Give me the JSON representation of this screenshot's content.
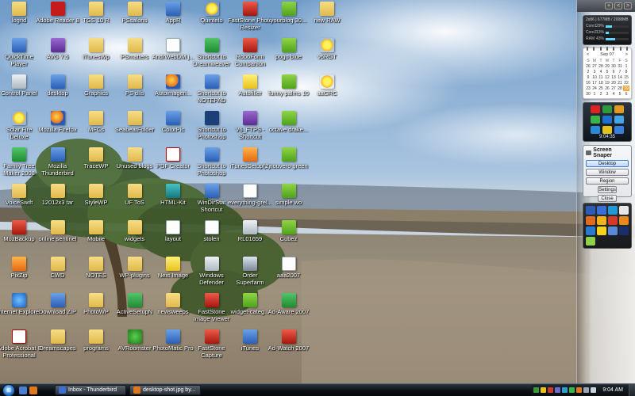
{
  "desktop": {
    "icons": [
      {
        "label": "logrid",
        "glyph": "folder",
        "col": 0,
        "row": 0
      },
      {
        "label": "Adobe Reader 8",
        "glyph": "pdf-red",
        "col": 1,
        "row": 0
      },
      {
        "label": "TGS 10 R",
        "glyph": "folder",
        "col": 2,
        "row": 0
      },
      {
        "label": "PSsalons",
        "glyph": "folder",
        "col": 3,
        "row": 0
      },
      {
        "label": "AppR",
        "glyph": "blue",
        "col": 4,
        "row": 0
      },
      {
        "label": "Quinteto",
        "glyph": "sun",
        "col": 5,
        "row": 0
      },
      {
        "label": "FastStone Photo Resizer",
        "glyph": "red",
        "col": 6,
        "row": 0
      },
      {
        "label": "yourblog 30...",
        "glyph": "pea",
        "col": 7,
        "row": 0
      },
      {
        "label": "new RAW",
        "glyph": "folder",
        "col": 8,
        "row": 0
      },
      {
        "label": "QuickTime Player",
        "glyph": "blue",
        "col": 0,
        "row": 1
      },
      {
        "label": "AVG 7.5",
        "glyph": "purple",
        "col": 1,
        "row": 1
      },
      {
        "label": "iTunesWp",
        "glyph": "folder",
        "col": 2,
        "row": 1
      },
      {
        "label": "PSmatters",
        "glyph": "folder",
        "col": 3,
        "row": 1
      },
      {
        "label": "AndrWebDM j...",
        "glyph": "doc",
        "col": 4,
        "row": 1
      },
      {
        "label": "Shortcut to Dreamweaver",
        "glyph": "green",
        "col": 5,
        "row": 1
      },
      {
        "label": "RoboForm Companion",
        "glyph": "red",
        "col": 6,
        "row": 1
      },
      {
        "label": "pogo blue",
        "glyph": "pea",
        "col": 7,
        "row": 1
      },
      {
        "label": "v6RGT",
        "glyph": "sun",
        "col": 8,
        "row": 1
      },
      {
        "label": "Control Panel",
        "glyph": "gray",
        "col": 0,
        "row": 2
      },
      {
        "label": "desktop",
        "glyph": "blue",
        "col": 1,
        "row": 2
      },
      {
        "label": "Graphics",
        "glyph": "folder",
        "col": 2,
        "row": 2
      },
      {
        "label": "PS dlls",
        "glyph": "folder",
        "col": 3,
        "row": 2
      },
      {
        "label": "Autoimageri...",
        "glyph": "fire",
        "col": 4,
        "row": 2
      },
      {
        "label": "Shortcut to NOTEPAD",
        "glyph": "blue",
        "col": 5,
        "row": 2
      },
      {
        "label": "Autofiller",
        "glyph": "yellow",
        "col": 6,
        "row": 2
      },
      {
        "label": "funny palms 10",
        "glyph": "pea",
        "col": 7,
        "row": 2
      },
      {
        "label": "aaGRC",
        "glyph": "sun",
        "col": 8,
        "row": 2
      },
      {
        "label": "Solar Fire Deluxe",
        "glyph": "sun",
        "col": 0,
        "row": 3
      },
      {
        "label": "Mozilla Firefox",
        "glyph": "fire",
        "col": 1,
        "row": 3
      },
      {
        "label": "MFCs",
        "glyph": "folder",
        "col": 2,
        "row": 3
      },
      {
        "label": "SeabeatFolder",
        "glyph": "folder",
        "col": 3,
        "row": 3
      },
      {
        "label": "ColorPic",
        "glyph": "blue",
        "col": 4,
        "row": 3
      },
      {
        "label": "Shortcut to Photoshop",
        "glyph": "ps",
        "col": 5,
        "row": 3
      },
      {
        "label": "V6_FTPS - Shortcut",
        "glyph": "purple",
        "col": 6,
        "row": 3
      },
      {
        "label": "octave drake...",
        "glyph": "pea",
        "col": 7,
        "row": 3
      },
      {
        "label": "Family Tree Maker 2008",
        "glyph": "green",
        "col": 0,
        "row": 4
      },
      {
        "label": "Mozilla Thunderbird",
        "glyph": "blue",
        "col": 1,
        "row": 4
      },
      {
        "label": "TraceWP",
        "glyph": "folder",
        "col": 2,
        "row": 4
      },
      {
        "label": "Unused blogs",
        "glyph": "folder",
        "col": 3,
        "row": 4
      },
      {
        "label": "PDF Creator",
        "glyph": "pdf",
        "col": 4,
        "row": 4
      },
      {
        "label": "Shortcut to Photoshop",
        "glyph": "blue",
        "col": 5,
        "row": 4
      },
      {
        "label": "iTunesSetup(2)",
        "glyph": "orange",
        "col": 6,
        "row": 4
      },
      {
        "label": "nouvero green",
        "glyph": "pea",
        "col": 7,
        "row": 4
      },
      {
        "label": "VoiceSwift",
        "glyph": "folder",
        "col": 0,
        "row": 5
      },
      {
        "label": "12012x3 tar",
        "glyph": "folder",
        "col": 1,
        "row": 5
      },
      {
        "label": "StyleWP",
        "glyph": "folder",
        "col": 2,
        "row": 5
      },
      {
        "label": "UF ToS",
        "glyph": "folder",
        "col": 3,
        "row": 5
      },
      {
        "label": "HTML-Kit",
        "glyph": "teal",
        "col": 4,
        "row": 5
      },
      {
        "label": "WinDirStat Shortcut",
        "glyph": "blue",
        "col": 5,
        "row": 5
      },
      {
        "label": "everything-grel...",
        "glyph": "doc",
        "col": 6,
        "row": 5
      },
      {
        "label": "simple wo",
        "glyph": "pea",
        "col": 7,
        "row": 5
      },
      {
        "label": "MozBackup",
        "glyph": "red",
        "col": 0,
        "row": 6
      },
      {
        "label": "online sentinel",
        "glyph": "folder",
        "col": 1,
        "row": 6
      },
      {
        "label": "Mobile",
        "glyph": "folder",
        "col": 2,
        "row": 6
      },
      {
        "label": "widgets",
        "glyph": "folder",
        "col": 3,
        "row": 6
      },
      {
        "label": "layout",
        "glyph": "doc",
        "col": 4,
        "row": 6
      },
      {
        "label": "stolen",
        "glyph": "doc",
        "col": 5,
        "row": 6
      },
      {
        "label": "RL01659",
        "glyph": "gray",
        "col": 6,
        "row": 6
      },
      {
        "label": "Cubez",
        "glyph": "pea",
        "col": 7,
        "row": 6
      },
      {
        "label": "PixZip",
        "glyph": "orange",
        "col": 0,
        "row": 7
      },
      {
        "label": "CWD",
        "glyph": "folder",
        "col": 1,
        "row": 7
      },
      {
        "label": "NOTES",
        "glyph": "folder",
        "col": 2,
        "row": 7
      },
      {
        "label": "WP-plugins",
        "glyph": "folder",
        "col": 3,
        "row": 7
      },
      {
        "label": "Next Image",
        "glyph": "yellow",
        "col": 4,
        "row": 7
      },
      {
        "label": "Windows Defender",
        "glyph": "gray",
        "col": 5,
        "row": 7
      },
      {
        "label": "Order Superfarm",
        "glyph": "cam",
        "col": 6,
        "row": 7
      },
      {
        "label": "aaa2007",
        "glyph": "doc",
        "col": 7,
        "row": 7
      },
      {
        "label": "Internet Explorer",
        "glyph": "ie",
        "col": 0,
        "row": 8
      },
      {
        "label": "Download ZIP",
        "glyph": "blue",
        "col": 1,
        "row": 8
      },
      {
        "label": "PhotoWP",
        "glyph": "folder",
        "col": 2,
        "row": 8
      },
      {
        "label": "ActiveSetupN",
        "glyph": "green",
        "col": 3,
        "row": 8
      },
      {
        "label": "newsweeps",
        "glyph": "folder",
        "col": 4,
        "row": 8
      },
      {
        "label": "FastStone Image Viewer",
        "glyph": "red",
        "col": 5,
        "row": 8
      },
      {
        "label": "widget-categ...",
        "glyph": "pea",
        "col": 6,
        "row": 8
      },
      {
        "label": "Ad-Aware 2007",
        "glyph": "green",
        "col": 7,
        "row": 8
      },
      {
        "label": "Adobe Acrobat 8 Professional",
        "glyph": "pdf",
        "col": 0,
        "row": 9
      },
      {
        "label": "Dreamscapes",
        "glyph": "folder",
        "col": 1,
        "row": 9
      },
      {
        "label": "programs",
        "glyph": "folder",
        "col": 2,
        "row": 9
      },
      {
        "label": "AVRoomster",
        "glyph": "frog",
        "col": 3,
        "row": 9
      },
      {
        "label": "PhotoMatic Pro",
        "glyph": "blue",
        "col": 4,
        "row": 9
      },
      {
        "label": "FastStone Capture",
        "glyph": "red",
        "col": 5,
        "row": 9
      },
      {
        "label": "iTunes",
        "glyph": "blue",
        "col": 6,
        "row": 9
      },
      {
        "label": "Ad-Watch 2007",
        "glyph": "red",
        "col": 7,
        "row": 9
      }
    ]
  },
  "sidebar": {
    "controls": [
      "+",
      "<",
      ">"
    ],
    "cpu_meter": {
      "header": "2x86 | 677MB / 2008MB",
      "rows": [
        {
          "name": "Core1",
          "percent": "29%",
          "value": 0.29
        },
        {
          "name": "Core2",
          "percent": "13%",
          "value": 0.13
        },
        {
          "name": "RAM",
          "percent": "43%",
          "value": 0.43
        }
      ]
    },
    "calendar": {
      "month": "Sep 07",
      "prev": "<",
      "next": ">",
      "weekdays": [
        "S",
        "M",
        "T",
        "W",
        "T",
        "F",
        "S"
      ],
      "weeks": [
        [
          "26",
          "27",
          "28",
          "29",
          "30",
          "31",
          "1"
        ],
        [
          "2",
          "3",
          "4",
          "5",
          "6",
          "7",
          "8"
        ],
        [
          "9",
          "10",
          "11",
          "12",
          "13",
          "14",
          "15"
        ],
        [
          "16",
          "17",
          "18",
          "19",
          "20",
          "21",
          "22"
        ],
        [
          "23",
          "24",
          "25",
          "26",
          "27",
          "28",
          "29"
        ],
        [
          "30",
          "1",
          "2",
          "3",
          "4",
          "5",
          "6"
        ]
      ],
      "today": "29"
    },
    "clock_gadget": {
      "time": "9:04:35"
    },
    "screen_snaper": {
      "title": "Screen Snaper",
      "buttons": {
        "desktop": "Desktop",
        "window": "Window",
        "region": "Region",
        "settings": "Settings",
        "close": "Close"
      }
    }
  },
  "taskbar": {
    "tasks": [
      {
        "label": "Inbox - Thunderbird",
        "icon": "thunderbird-icon"
      },
      {
        "label": "desktop-shot.jpg by...",
        "icon": "firefox-icon"
      }
    ],
    "clock": "9:04 AM"
  },
  "colors": {
    "taskbar": "#0b1016",
    "sky": "#7fa7cc",
    "sidebar": "#e9ebee",
    "accent": "#3b8de0"
  }
}
